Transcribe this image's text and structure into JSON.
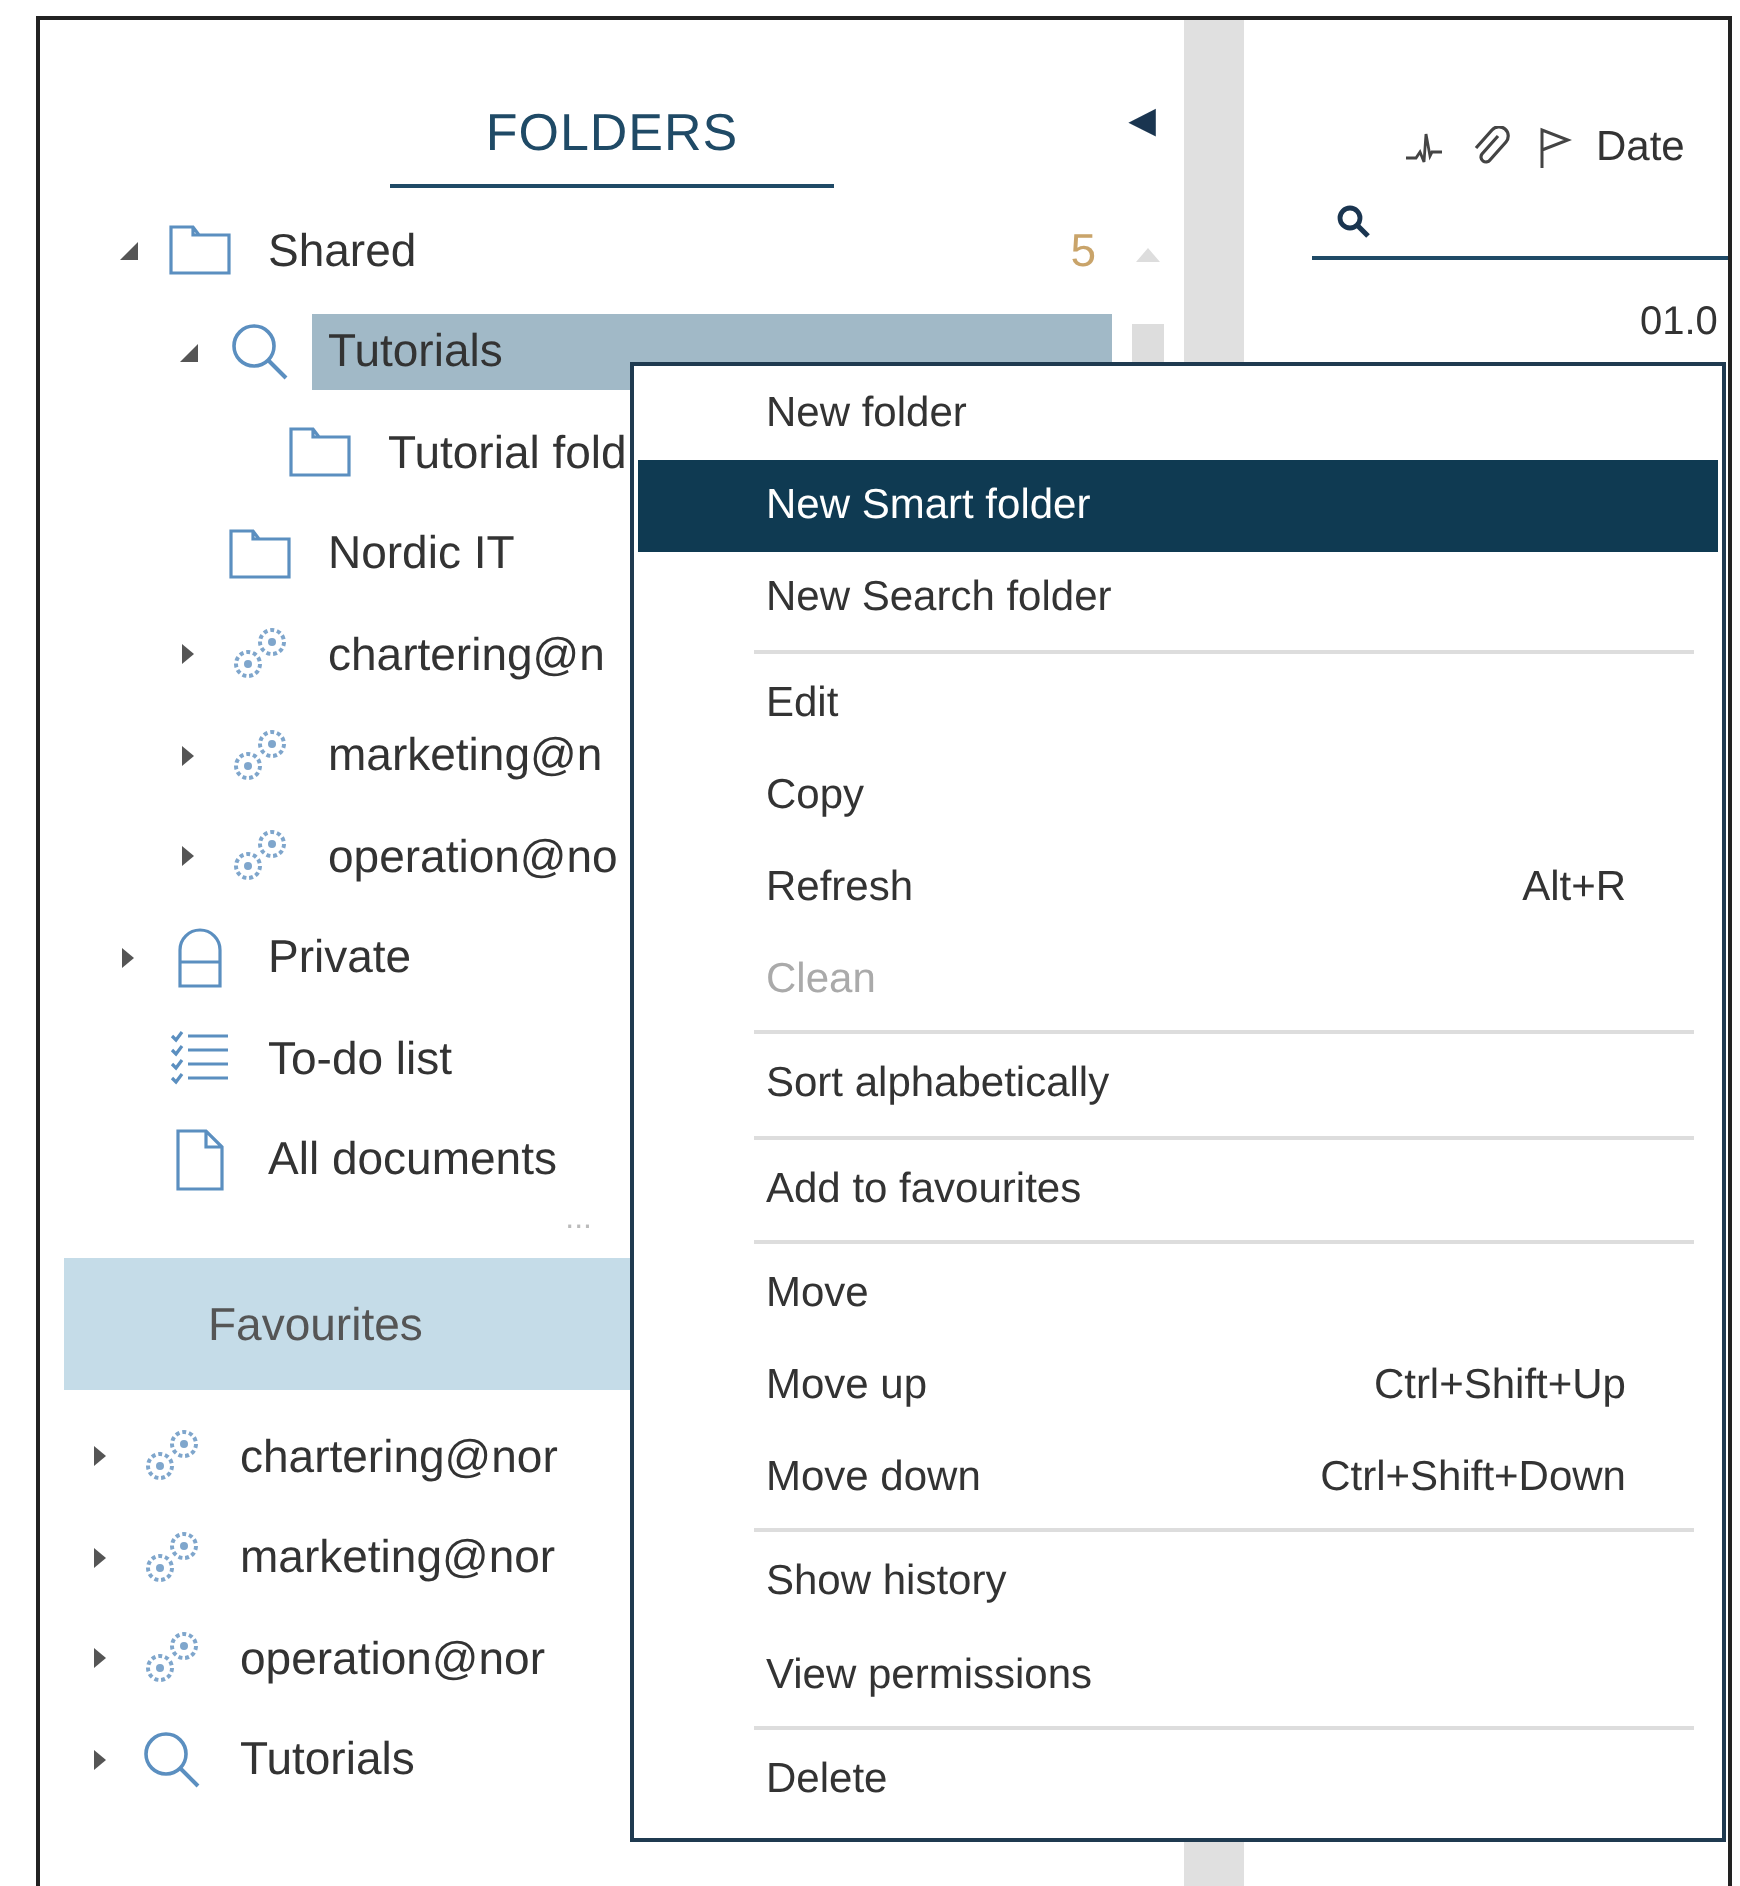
{
  "folders_panel": {
    "title": "FOLDERS",
    "collapse_glyph": "◀",
    "tree": [
      {
        "label": "Shared",
        "kind": "folder",
        "count": "5",
        "expanded": true,
        "selected": false,
        "children": [
          {
            "label": "Tutorials",
            "kind": "search",
            "expanded": true,
            "selected": true,
            "children": [
              {
                "label": "Tutorial fold",
                "kind": "folder",
                "selected": false
              }
            ]
          },
          {
            "label": "Nordic IT",
            "kind": "folder",
            "selected": false
          },
          {
            "label": "chartering@n",
            "kind": "gears",
            "expanded": false,
            "selected": false
          },
          {
            "label": "marketing@n",
            "kind": "gears",
            "expanded": false,
            "selected": false
          },
          {
            "label": "operation@no",
            "kind": "gears",
            "expanded": false,
            "selected": false
          }
        ]
      },
      {
        "label": "Private",
        "kind": "lock",
        "expanded": false,
        "selected": false
      },
      {
        "label": "To-do list",
        "kind": "todo",
        "selected": false
      },
      {
        "label": "All documents",
        "kind": "document",
        "selected": false
      }
    ],
    "more_glyph": "...",
    "favourites_title": "Favourites",
    "favourites": [
      {
        "label": "chartering@nor",
        "kind": "gears",
        "expanded": false
      },
      {
        "label": "marketing@nor",
        "kind": "gears",
        "expanded": false
      },
      {
        "label": "operation@nor",
        "kind": "gears",
        "expanded": false
      },
      {
        "label": "Tutorials",
        "kind": "search",
        "expanded": false
      }
    ]
  },
  "list_pane": {
    "column_header": "Date",
    "first_cell": "01.0"
  },
  "context_menu": {
    "sections": [
      [
        {
          "label": "New folder",
          "selected": false,
          "disabled": false
        },
        {
          "label": "New Smart folder",
          "selected": true,
          "disabled": false
        },
        {
          "label": "New Search folder",
          "selected": false,
          "disabled": false
        }
      ],
      [
        {
          "label": "Edit",
          "selected": false,
          "disabled": false
        },
        {
          "label": "Copy",
          "selected": false,
          "disabled": false
        },
        {
          "label": "Refresh",
          "shortcut": "Alt+R",
          "selected": false,
          "disabled": false
        },
        {
          "label": "Clean",
          "selected": false,
          "disabled": true
        }
      ],
      [
        {
          "label": "Sort alphabetically",
          "selected": false,
          "disabled": false
        }
      ],
      [
        {
          "label": "Add to favourites",
          "selected": false,
          "disabled": false
        }
      ],
      [
        {
          "label": "Move",
          "selected": false,
          "disabled": false
        },
        {
          "label": "Move up",
          "shortcut": "Ctrl+Shift+Up",
          "selected": false,
          "disabled": false
        },
        {
          "label": "Move down",
          "shortcut": "Ctrl+Shift+Down",
          "selected": false,
          "disabled": false
        }
      ],
      [
        {
          "label": "Show history",
          "selected": false,
          "disabled": false
        },
        {
          "label": "View permissions",
          "selected": false,
          "disabled": false
        }
      ],
      [
        {
          "label": "Delete",
          "selected": false,
          "disabled": false
        }
      ]
    ]
  }
}
